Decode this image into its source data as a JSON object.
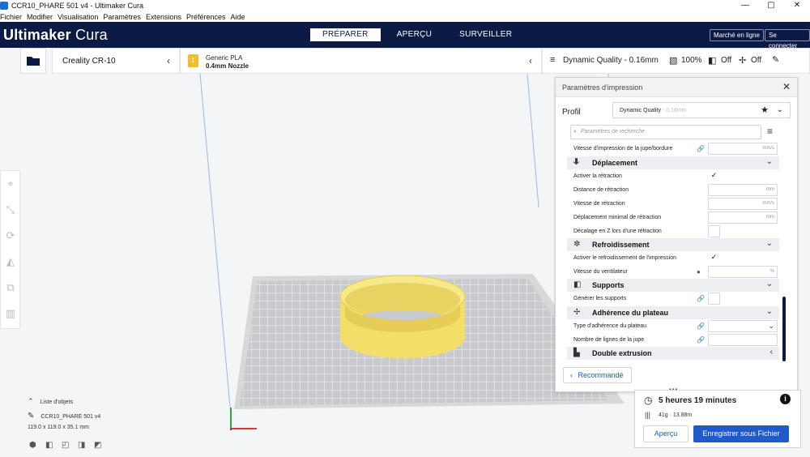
{
  "window": {
    "title": "CCR10_PHARE 501 v4 - Ultimaker Cura",
    "minimize": "—",
    "maximize": "▢",
    "close": "✕"
  },
  "menu": [
    "Fichier",
    "Modifier",
    "Visualisation",
    "Paramètres",
    "Extensions",
    "Préférences",
    "Aide"
  ],
  "header": {
    "brand_bold": "Ultimaker",
    "brand_light": " Cura",
    "stages": [
      "PRÉPARER",
      "APERÇU",
      "SURVEILLER"
    ],
    "marketplace": "Marché en ligne",
    "signin": "Se connecter"
  },
  "toolbar": {
    "machine": "Creality CR-10",
    "material": "Generic PLA",
    "nozzle": "0.4mm Nozzle",
    "badge": "1",
    "quality": "Dynamic Quality - 0.16mm",
    "infill": "100%",
    "support": "Off",
    "adhesion": "Off"
  },
  "objects": {
    "toggle": "Liste d'objets",
    "name": "CCR10_PHARE 501 v4",
    "dims": "119.0 x 119.0 x 35.1 mm"
  },
  "panel": {
    "title": "Paramètres d'impression",
    "profile_label": "Profil",
    "profile_value": "Dynamic Quality",
    "profile_suffix": "- 0.16mm",
    "search_placeholder": "Paramètres de recherche",
    "rows": {
      "skirt_speed": {
        "label": "Vitesse d'impression de la jupe/bordure",
        "unit": "mm/s"
      },
      "cat_travel": "Déplacement",
      "retraction": {
        "label": "Activer la rétraction",
        "check": "✓"
      },
      "retract_dist": {
        "label": "Distance de rétraction",
        "unit": "mm"
      },
      "retract_speed": {
        "label": "Vitesse de rétraction",
        "unit": "mm/s"
      },
      "min_travel": {
        "label": "Déplacement minimal de rétraction",
        "unit": "mm"
      },
      "z_hop": {
        "label": "Décalage en Z lors d'une rétraction"
      },
      "cat_cooling": "Refroidissement",
      "cooling": {
        "label": "Activer le refroidissement de l'impression",
        "check": "✓"
      },
      "fan_speed": {
        "label": "Vitesse du ventilateur",
        "unit": "%"
      },
      "cat_support": "Supports",
      "gen_support": {
        "label": "Générer les supports"
      },
      "cat_adhesion": "Adhérence du plateau",
      "adhesion_type": {
        "label": "Type d'adhérence du plateau"
      },
      "skirt_lines": {
        "label": "Nombre de lignes de la jupe"
      },
      "cat_dual": "Double extrusion"
    },
    "recommended": "Recommandé"
  },
  "estimate": {
    "time": "5 heures 19 minutes",
    "material": "41g · 13.88m",
    "preview": "Aperçu",
    "save": "Enregistrer sous Fichier"
  },
  "colors": {
    "header": "#0c1b45",
    "accent": "#1e5ac9",
    "model": "#f7e47c",
    "plate": "#c9cacd"
  }
}
